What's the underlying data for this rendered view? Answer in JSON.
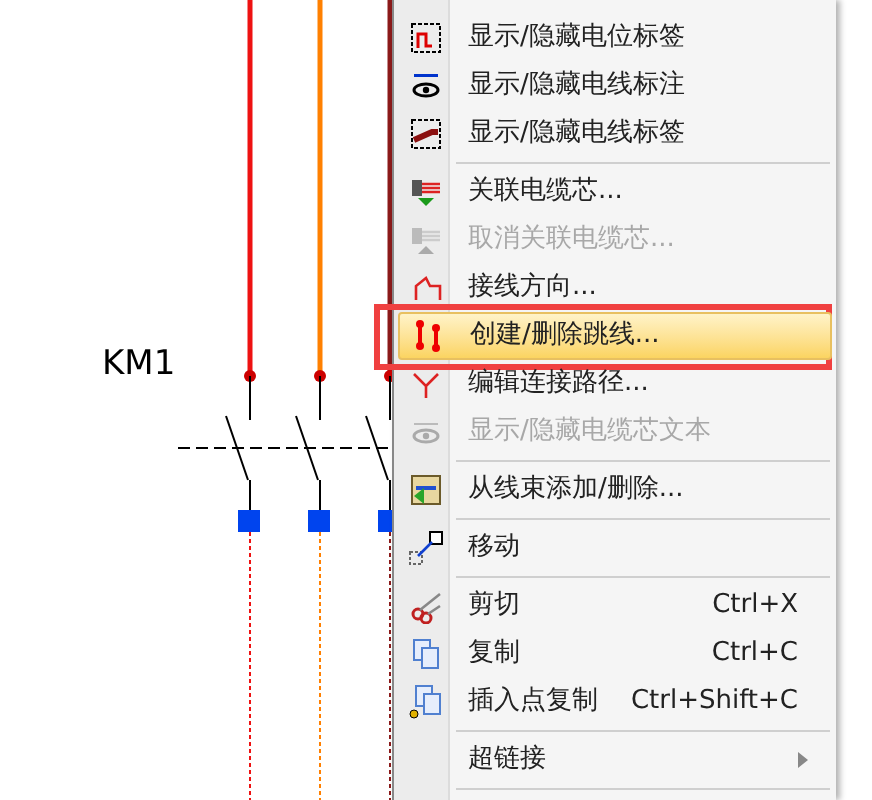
{
  "diagram": {
    "label": "KM1"
  },
  "context_menu": {
    "items": [
      {
        "kind": "item",
        "label": "显示/隐藏电位标签",
        "disabled": false,
        "selected": false
      },
      {
        "kind": "item",
        "label": "显示/隐藏电线标注",
        "disabled": false,
        "selected": false
      },
      {
        "kind": "item",
        "label": "显示/隐藏电线标签",
        "disabled": false,
        "selected": false
      },
      {
        "kind": "separator"
      },
      {
        "kind": "item",
        "label": "关联电缆芯...",
        "disabled": false,
        "selected": false
      },
      {
        "kind": "item",
        "label": "取消关联电缆芯...",
        "disabled": true,
        "selected": false
      },
      {
        "kind": "item",
        "label": "接线方向...",
        "disabled": false,
        "selected": false
      },
      {
        "kind": "item",
        "label": "创建/删除跳线...",
        "disabled": false,
        "selected": true
      },
      {
        "kind": "item",
        "label": "编辑连接路径...",
        "disabled": false,
        "selected": false
      },
      {
        "kind": "item",
        "label": "显示/隐藏电缆芯文本",
        "disabled": true,
        "selected": false
      },
      {
        "kind": "separator"
      },
      {
        "kind": "item",
        "label": "从线束添加/删除...",
        "disabled": false,
        "selected": false
      },
      {
        "kind": "separator"
      },
      {
        "kind": "item",
        "label": "移动",
        "disabled": false,
        "selected": false
      },
      {
        "kind": "separator"
      },
      {
        "kind": "item",
        "label": "剪切",
        "shortcut": "Ctrl+X",
        "disabled": false,
        "selected": false
      },
      {
        "kind": "item",
        "label": "复制",
        "shortcut": "Ctrl+C",
        "disabled": false,
        "selected": false
      },
      {
        "kind": "item",
        "label": "插入点复制",
        "shortcut": "Ctrl+Shift+C",
        "disabled": false,
        "selected": false
      },
      {
        "kind": "separator"
      },
      {
        "kind": "submenu",
        "label": "超链接",
        "disabled": false,
        "selected": false
      },
      {
        "kind": "separator"
      }
    ]
  }
}
